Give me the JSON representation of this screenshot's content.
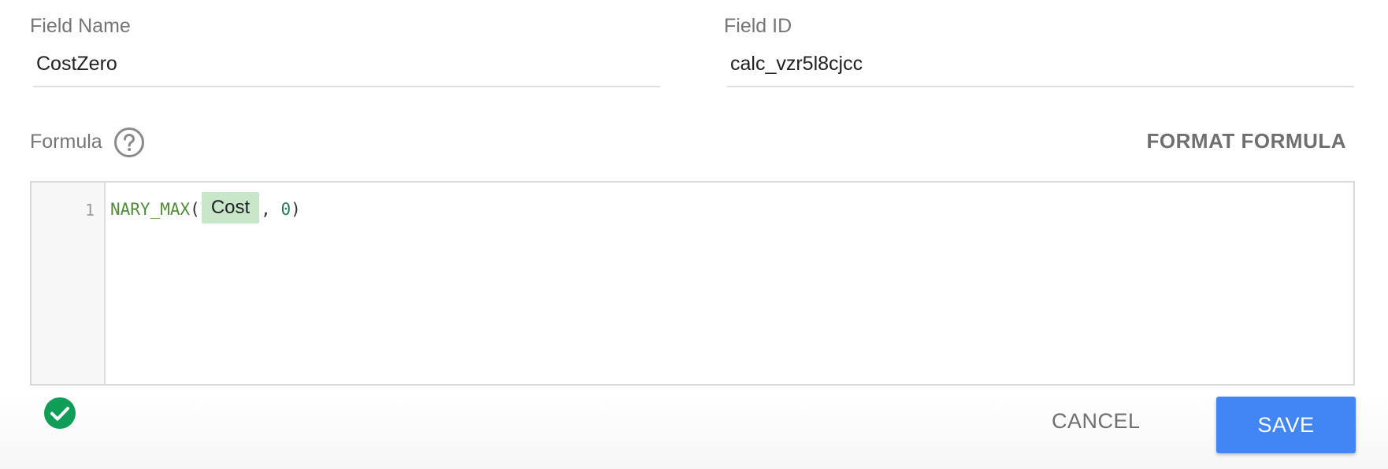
{
  "form": {
    "field_name": {
      "label": "Field Name",
      "value": "CostZero"
    },
    "field_id": {
      "label": "Field ID",
      "value": "calc_vzr5l8cjcc"
    },
    "formula": {
      "label": "Formula",
      "help_icon": "help-circle-icon",
      "format_label": "FORMAT FORMULA"
    }
  },
  "editor": {
    "line_number": "1",
    "tokens": {
      "function": "NARY_MAX",
      "open_paren": "(",
      "field_chip": "Cost",
      "comma": ", ",
      "number": "0",
      "close_paren": ")"
    }
  },
  "status": {
    "icon": "check-circle-icon",
    "color": "#0f9d58"
  },
  "actions": {
    "cancel_label": "CANCEL",
    "save_label": "SAVE",
    "save_color": "#4285f4"
  }
}
